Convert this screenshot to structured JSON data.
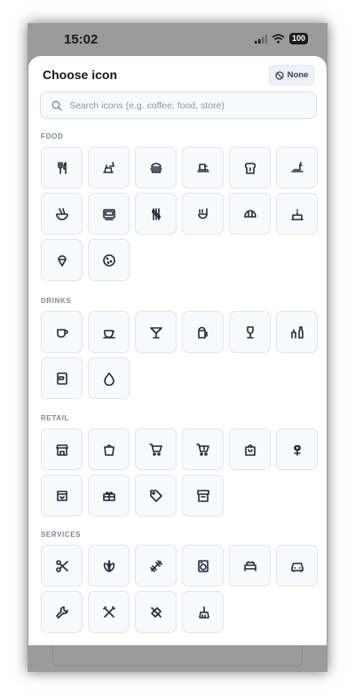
{
  "status": {
    "time": "15:02",
    "battery": "100"
  },
  "sheet": {
    "title": "Choose icon",
    "none_label": "None",
    "search_placeholder": "Search icons (e.g. coffee, food, store)"
  },
  "sections": [
    {
      "label": "FOOD",
      "icons": [
        "utensils-icon",
        "takeout-food-icon",
        "burger-icon",
        "sandwich-icon",
        "toast-icon",
        "bottle-plate-icon",
        "noodle-bowl-icon",
        "bento-icon",
        "skewer-icon",
        "ladle-icon",
        "croissant-icon",
        "cake-icon",
        "ice-cream-icon",
        "cookie-icon"
      ]
    },
    {
      "label": "DRINKS",
      "icons": [
        "coffee-cup-icon",
        "tea-cup-icon",
        "cocktail-icon",
        "beer-mug-icon",
        "wine-glass-icon",
        "wine-bottle-icon",
        "coffee-machine-icon",
        "water-drop-icon"
      ]
    },
    {
      "label": "RETAIL",
      "icons": [
        "storefront-icon",
        "shopping-bag-icon",
        "shopping-cart-icon",
        "cart-icon",
        "tote-bag-icon",
        "flower-icon",
        "rug-icon",
        "gift-box-icon",
        "price-tag-icon",
        "archive-box-icon"
      ]
    },
    {
      "label": "SERVICES",
      "icons": [
        "scissors-icon",
        "spa-leaf-icon",
        "dumbbell-icon",
        "washing-machine-icon",
        "bed-icon",
        "car-icon",
        "wrench-icon",
        "tools-icon",
        "bandage-icon",
        "broom-icon"
      ]
    }
  ]
}
